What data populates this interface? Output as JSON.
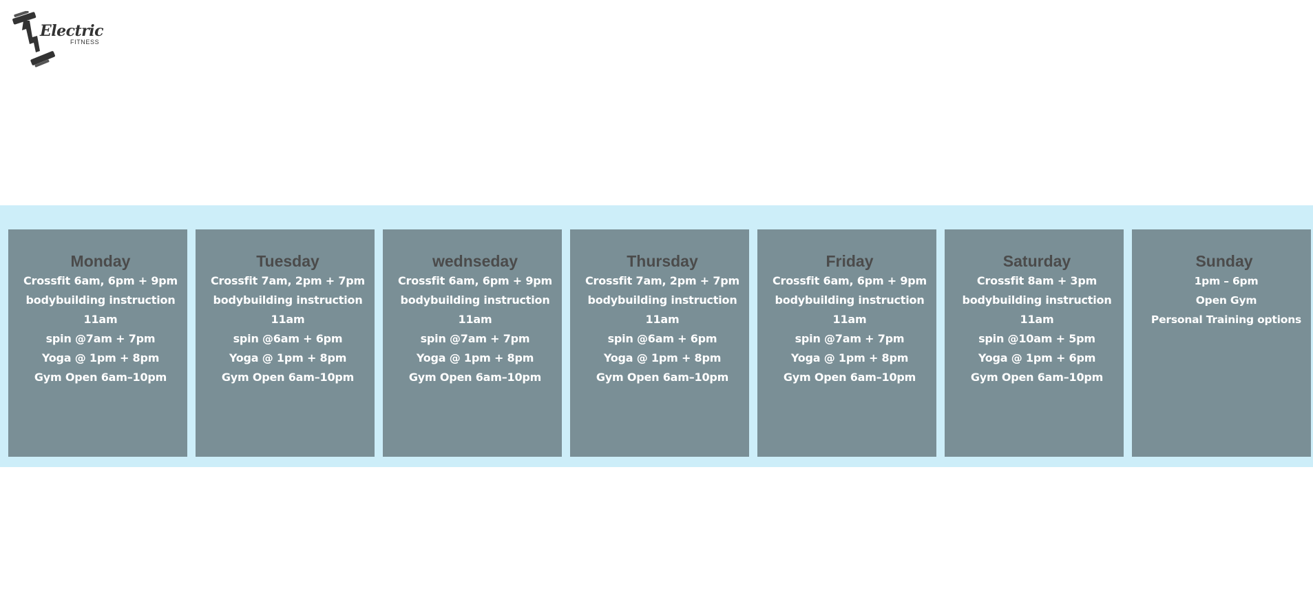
{
  "brand": {
    "name": "Electric",
    "sub": "FITNESS",
    "logo_icon": "lightning-dumbbell-icon",
    "colors": {
      "logo": "#333333",
      "band": "#cdeef9",
      "card": "#7a8f96",
      "day_title": "#4b4b4b",
      "line_text": "#ffffff"
    }
  },
  "schedule": {
    "days": [
      {
        "title": "Monday",
        "lines": [
          "Crossfit 6am, 6pm + 9pm",
          "bodybuilding instruction",
          "11am",
          "spin @7am + 7pm",
          "Yoga @ 1pm + 8pm",
          "Gym Open 6am–10pm"
        ]
      },
      {
        "title": "Tuesday",
        "lines": [
          "Crossfit 7am, 2pm + 7pm",
          "bodybuilding instruction",
          "11am",
          "spin @6am + 6pm",
          "Yoga @ 1pm + 8pm",
          "Gym Open 6am–10pm"
        ]
      },
      {
        "title": "wednseday",
        "lines": [
          "Crossfit 6am, 6pm + 9pm",
          "bodybuilding instruction",
          "11am",
          "spin @7am + 7pm",
          "Yoga @ 1pm + 8pm",
          "Gym Open 6am–10pm"
        ]
      },
      {
        "title": "Thursday",
        "lines": [
          "Crossfit 7am, 2pm + 7pm",
          "bodybuilding instruction",
          "11am",
          "spin @6am + 6pm",
          "Yoga @ 1pm + 8pm",
          "Gym Open 6am–10pm"
        ]
      },
      {
        "title": "Friday",
        "lines": [
          "Crossfit 6am, 6pm + 9pm",
          "bodybuilding instruction",
          "11am",
          "spin @7am + 7pm",
          "Yoga @ 1pm + 8pm",
          "Gym Open 6am–10pm"
        ]
      },
      {
        "title": "Saturday",
        "lines": [
          "Crossfit 8am + 3pm",
          "bodybuilding instruction",
          "11am",
          "spin @10am + 5pm",
          "Yoga @ 1pm + 6pm",
          "Gym Open 6am–10pm"
        ]
      },
      {
        "title": "Sunday",
        "lines": [
          "1pm – 6pm",
          "Open Gym",
          "Personal Training options"
        ]
      }
    ]
  }
}
